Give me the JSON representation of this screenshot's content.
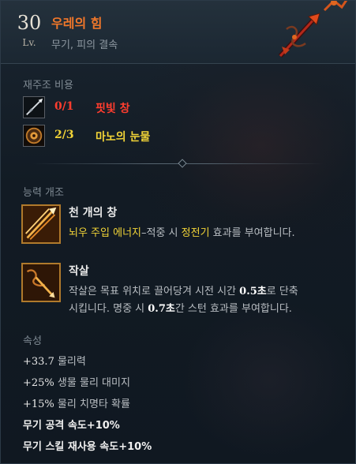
{
  "header": {
    "level": "30",
    "level_label": "Lv.",
    "title": "우레의 힘",
    "subtitle": "무기, 피의 결속",
    "weapon_icon": "blood-chain-spear-icon"
  },
  "reforge_cost": {
    "label": "재주조 비용",
    "materials": [
      {
        "count": "0/1",
        "name": "핏빛 창",
        "icon": "bloody-spear-icon",
        "color": "#ff3d2e"
      },
      {
        "count": "2/3",
        "name": "마노의 눈물",
        "icon": "agate-tear-icon",
        "color": "#f2d437"
      }
    ]
  },
  "ability_mod": {
    "label": "능력 개조",
    "skills": [
      {
        "name": "천 개의 창",
        "icon": "thousand-spears-icon",
        "desc_parts": [
          "뇌우 주입 에너지",
          "–적중 시 ",
          "정전기",
          " 효과를 부여합니다."
        ]
      },
      {
        "name": "작살",
        "icon": "harpoon-icon",
        "line1_parts": [
          "작살은 목표 위치로 끌어당겨 시전 시간 ",
          "0.5초",
          "로 단축"
        ],
        "line2_parts": [
          "시킵니다. 명중 시 ",
          "0.7초",
          "간 스턴 효과를 부여합니다."
        ]
      }
    ]
  },
  "attributes": {
    "label": "속성",
    "items": [
      {
        "value": "+33.7",
        "text": " 물리력"
      },
      {
        "value": "+25%",
        "text": " 생물 물리 대미지"
      },
      {
        "value": "+15%",
        "text": " 물리 치명타 확률"
      },
      {
        "value": "",
        "text": "무기 공격 속도+10%"
      },
      {
        "value": "",
        "text": "무기 스킬 재사용 속도+10%"
      }
    ]
  },
  "colors": {
    "title": "#f0772a",
    "unmet": "#ff3d2e",
    "highlight": "#f2d437"
  }
}
